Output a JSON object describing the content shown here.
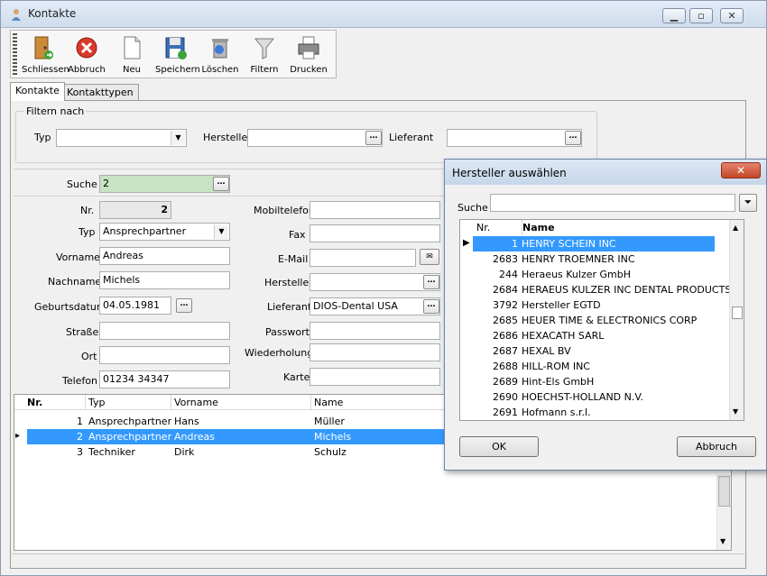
{
  "window": {
    "title": "Kontakte"
  },
  "toolbar": {
    "schliessen": "Schliessen",
    "abbruch": "Abbruch",
    "neu": "Neu",
    "speichern": "Speichern",
    "loeschen": "Löschen",
    "filtern": "Filtern",
    "drucken": "Drucken"
  },
  "tabs": [
    "Kontakte",
    "Kontakttypen"
  ],
  "filter": {
    "group_title": "Filtern nach",
    "typ_label": "Typ",
    "typ_value": "",
    "hersteller_label": "Hersteller",
    "hersteller_value": "",
    "lieferant_label": "Lieferant",
    "lieferant_value": ""
  },
  "search": {
    "label": "Suche",
    "value": "2"
  },
  "form": {
    "nr_label": "Nr.",
    "nr_value": "2",
    "typ_label": "Typ",
    "typ_value": "Ansprechpartner",
    "vorname_label": "Vorname",
    "vorname_value": "Andreas",
    "nachname_label": "Nachname",
    "nachname_value": "Michels",
    "geburtsdatum_label": "Geburtsdatum",
    "geburtsdatum_value": "04.05.1981",
    "strasse_label": "Straße",
    "strasse_value": "",
    "ort_label": "Ort",
    "ort_value": "",
    "telefon_label": "Telefon",
    "telefon_value": "01234 34347",
    "mobil_label": "Mobiltelefon",
    "mobil_value": "",
    "fax_label": "Fax",
    "fax_value": "",
    "email_label": "E-Mail",
    "email_value": "",
    "hersteller_label": "Hersteller",
    "hersteller_value": "",
    "lieferant_label": "Lieferant",
    "lieferant_value": "DIOS-Dental USA",
    "passwort_label": "Passwort",
    "passwort_value": "",
    "wiederholung_label": "Wiederholung",
    "wiederholung_value": "",
    "karte_label": "Karte",
    "karte_value": ""
  },
  "grid": {
    "headers": [
      "Nr.",
      "Typ",
      "Vorname",
      "Name"
    ],
    "rows": [
      {
        "nr": "1",
        "typ": "Ansprechpartner",
        "vorname": "Hans",
        "name": "Müller"
      },
      {
        "nr": "2",
        "typ": "Ansprechpartner",
        "vorname": "Andreas",
        "name": "Michels"
      },
      {
        "nr": "3",
        "typ": "Techniker",
        "vorname": "Dirk",
        "name": "Schulz"
      }
    ]
  },
  "dialog": {
    "title": "Hersteller auswählen",
    "search_label": "Suche",
    "search_value": "",
    "col_nr": "Nr.",
    "col_name": "Name",
    "rows": [
      {
        "nr": "1",
        "name": "HENRY SCHEIN INC"
      },
      {
        "nr": "2683",
        "name": "HENRY TROEMNER INC"
      },
      {
        "nr": "244",
        "name": "Heraeus Kulzer GmbH"
      },
      {
        "nr": "2684",
        "name": "HERAEUS KULZER INC DENTAL PRODUCTS G"
      },
      {
        "nr": "3792",
        "name": "Hersteller EGTD"
      },
      {
        "nr": "2685",
        "name": "HEUER TIME & ELECTRONICS CORP"
      },
      {
        "nr": "2686",
        "name": "HEXACATH SARL"
      },
      {
        "nr": "2687",
        "name": "HEXAL BV"
      },
      {
        "nr": "2688",
        "name": "HILL-ROM INC"
      },
      {
        "nr": "2689",
        "name": "Hint-Els GmbH"
      },
      {
        "nr": "2690",
        "name": "HOECHST-HOLLAND N.V."
      },
      {
        "nr": "2691",
        "name": "Hofmann s.r.l."
      }
    ],
    "ok_label": "OK",
    "abbruch_label": "Abbruch"
  }
}
